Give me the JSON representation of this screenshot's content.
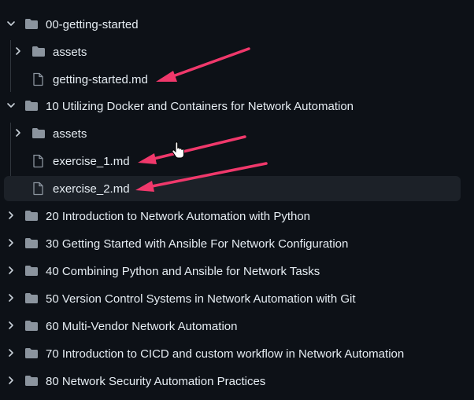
{
  "tree": {
    "items": [
      {
        "label": "00-getting-started",
        "kind": "folder",
        "expanded": true
      },
      {
        "label": "assets",
        "kind": "folder",
        "expanded": false
      },
      {
        "label": "getting-started.md",
        "kind": "file"
      },
      {
        "label": "10 Utilizing Docker and Containers for Network Automation",
        "kind": "folder",
        "expanded": true
      },
      {
        "label": "assets",
        "kind": "folder",
        "expanded": false
      },
      {
        "label": "exercise_1.md",
        "kind": "file"
      },
      {
        "label": "exercise_2.md",
        "kind": "file",
        "selected": true
      },
      {
        "label": "20 Introduction to Network Automation with Python",
        "kind": "folder",
        "expanded": false
      },
      {
        "label": "30 Getting Started with Ansible For Network Configuration",
        "kind": "folder",
        "expanded": false
      },
      {
        "label": "40 Combining Python and Ansible for Network Tasks",
        "kind": "folder",
        "expanded": false
      },
      {
        "label": "50 Version Control Systems in Network Automation with Git",
        "kind": "folder",
        "expanded": false
      },
      {
        "label": "60 Multi-Vendor Network Automation",
        "kind": "folder",
        "expanded": false
      },
      {
        "label": "70 Introduction to CICD and custom workflow in Network Automation",
        "kind": "folder",
        "expanded": false
      },
      {
        "label": "80 Network Security Automation Practices",
        "kind": "folder",
        "expanded": false
      }
    ]
  },
  "colors": {
    "background": "#0d1117",
    "text": "#e6edf3",
    "icon": "#8b949e",
    "selected": "#1c2128",
    "arrow": "#f0386b"
  },
  "icons": {
    "chevron_open": "chevron-down-icon",
    "chevron_closed": "chevron-right-icon",
    "folder": "folder-icon",
    "file": "file-icon"
  }
}
